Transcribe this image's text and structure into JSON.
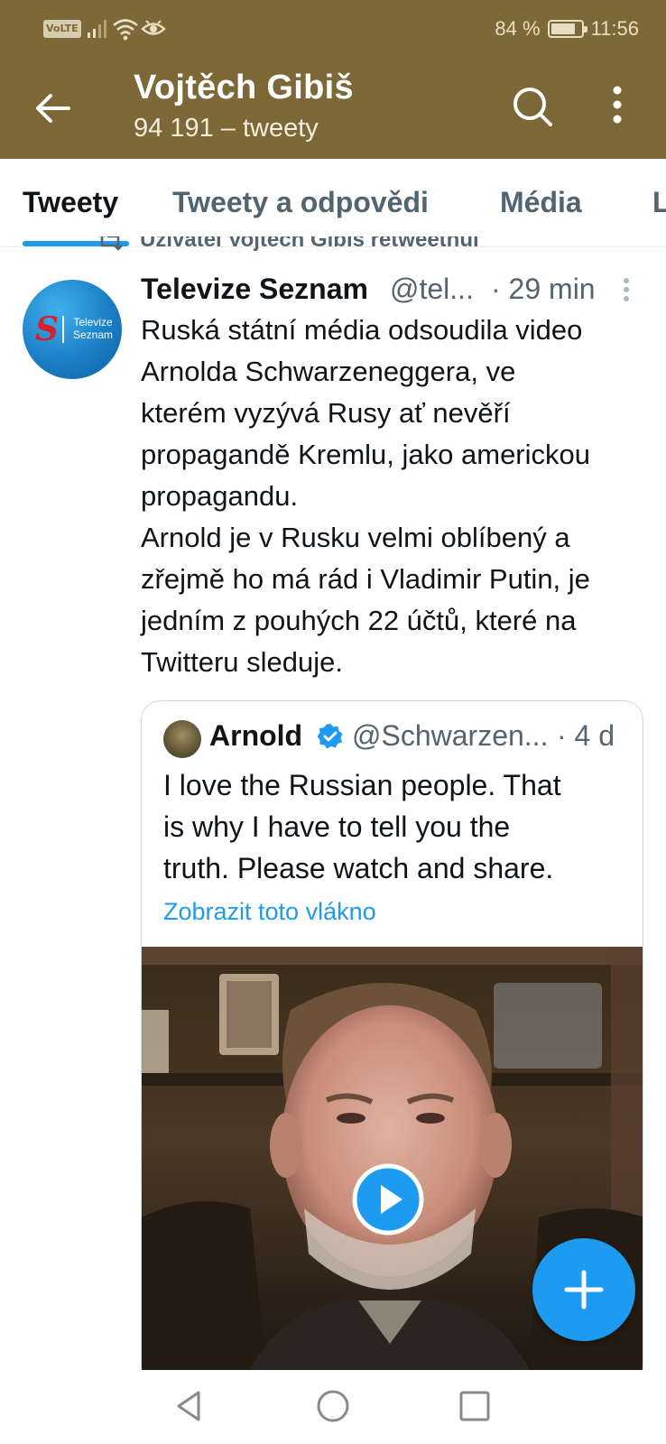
{
  "status_bar": {
    "volte": "VoLTE",
    "battery_percent_text": "84 %",
    "battery_level": 0.84,
    "time": "11:56"
  },
  "header": {
    "title": "Vojtěch Gibiš",
    "subtitle": "94 191 – tweety",
    "back_icon": "arrow-left-icon",
    "search_icon": "search-icon",
    "more_icon": "more-vertical-icon"
  },
  "tabs": [
    {
      "label": "Tweety",
      "active": true
    },
    {
      "label": "Tweety a odpovědi",
      "active": false
    },
    {
      "label": "Média",
      "active": false
    },
    {
      "label": "L",
      "active": false
    }
  ],
  "tweet": {
    "retweet_label": "Uživatel Vojtěch Gibiš retweetnul",
    "avatar_text": "Televize Seznam",
    "author": "Televize Seznam",
    "handle": "@tel...",
    "time": "· 29 min",
    "text_lines": [
      "Ruská státní média odsoudila video",
      "Arnolda Schwarzeneggera, ve",
      "kterém vyzývá Rusy ať nevěří",
      "propagandě Kremlu, jako americkou",
      "propagandu.",
      "Arnold je v Rusku velmi oblíbený a",
      "zřejmě ho má rád i Vladimir Putin, je",
      "jedním z pouhých 22 účtů, které na",
      "Twitteru sleduje."
    ],
    "quote": {
      "author": "Arnold",
      "verified": true,
      "handle": "@Schwarzen...",
      "time": "· 4 d",
      "text_lines": [
        "I love the Russian people. That",
        "is why I have to tell you the",
        "truth. Please watch and share."
      ],
      "link": "Zobrazit toto vlákno",
      "media_icon": "play-icon"
    }
  },
  "fab": {
    "icon": "plus-icon"
  },
  "navbar": {
    "icons": [
      "back-triangle-icon",
      "home-circle-icon",
      "recents-square-icon"
    ]
  },
  "colors": {
    "header_bg": "#7d6837",
    "accent": "#1d9bf0",
    "secondary_text": "#536471"
  }
}
